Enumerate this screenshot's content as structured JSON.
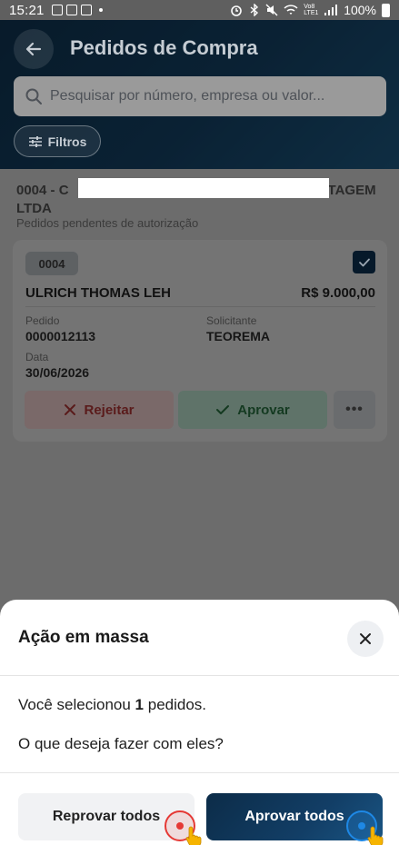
{
  "status_bar": {
    "time": "15:21",
    "right_text": "100%",
    "net_label": "Vo8 LTE1"
  },
  "header": {
    "title": "Pedidos de Compra",
    "search_placeholder": "Pesquisar por número, empresa ou valor...",
    "filters_label": "Filtros"
  },
  "group": {
    "title_visible": "0004 - C",
    "title_suffix": "TAGEM",
    "title_line2": "LTDA",
    "subtitle": "Pedidos pendentes de autorização"
  },
  "card": {
    "code": "0004",
    "company": "ULRICH THOMAS LEH",
    "amount": "R$ 9.000,00",
    "pedido_label": "Pedido",
    "pedido_value": "0000012113",
    "solicitante_label": "Solicitante",
    "solicitante_value": "TEOREMA",
    "data_label": "Data",
    "data_value": "30/06/2026",
    "reject_label": "Rejeitar",
    "approve_label": "Aprovar",
    "more_label": "•••",
    "selected": true
  },
  "sheet": {
    "title": "Ação em massa",
    "line1_prefix": "Você selecionou ",
    "line1_count": "1",
    "line1_suffix": " pedidos.",
    "line2": "O que deseja fazer com eles?",
    "reprovar_label": "Reprovar todos",
    "aprovar_label": "Aprovar todos"
  },
  "colors": {
    "brand_dark": "#0c2c48",
    "reject_accent": "#e53935",
    "approve_accent": "#1e88e5"
  }
}
